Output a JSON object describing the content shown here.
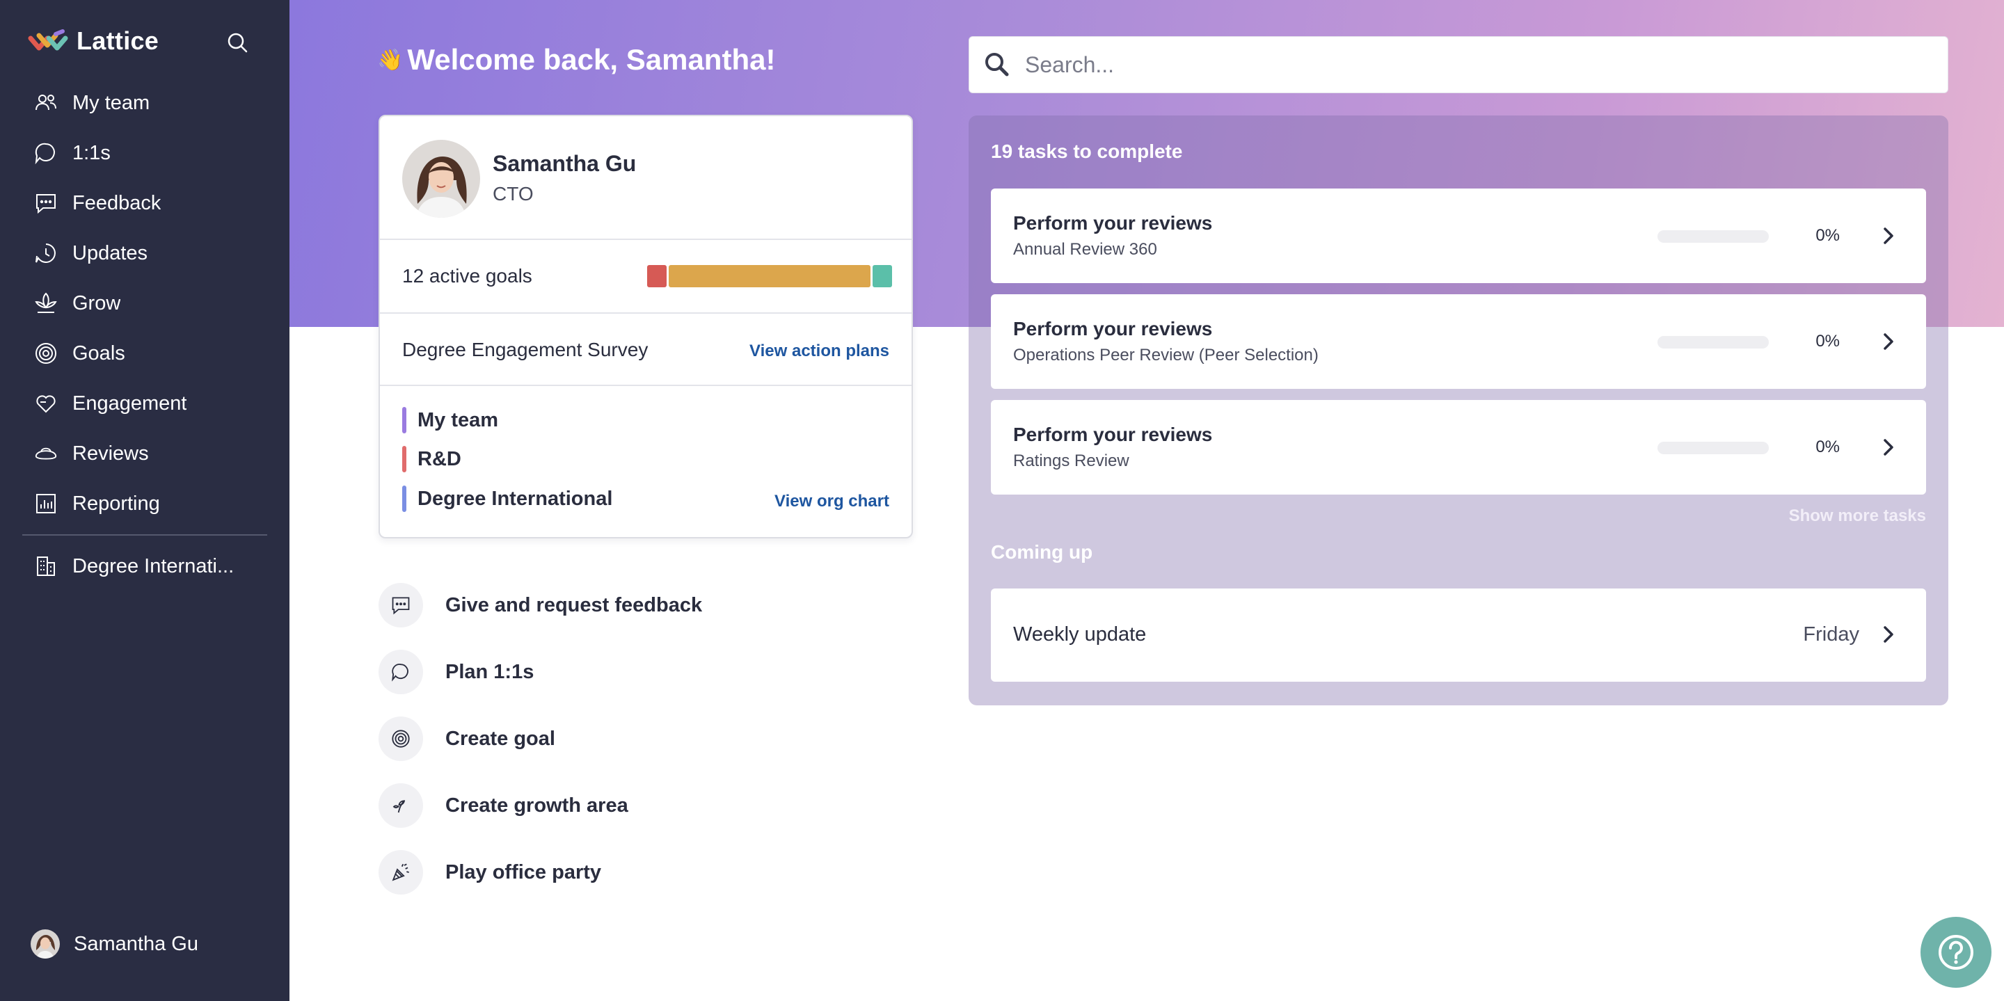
{
  "app": {
    "name": "Lattice",
    "brand_colors": [
      "#e05a4f",
      "#e8a93b",
      "#6cc2b4",
      "#9a7be0"
    ]
  },
  "sidebar": {
    "items": [
      {
        "label": "My team",
        "icon": "people-icon"
      },
      {
        "label": "1:1s",
        "icon": "chat-bubble-icon"
      },
      {
        "label": "Feedback",
        "icon": "feedback-icon"
      },
      {
        "label": "Updates",
        "icon": "updates-icon"
      },
      {
        "label": "Grow",
        "icon": "sprout-icon"
      },
      {
        "label": "Goals",
        "icon": "target-icon"
      },
      {
        "label": "Engagement",
        "icon": "heart-icon"
      },
      {
        "label": "Reviews",
        "icon": "reviews-icon"
      },
      {
        "label": "Reporting",
        "icon": "bar-chart-icon"
      }
    ],
    "org_item": {
      "label": "Degree Internati...",
      "icon": "building-icon"
    },
    "user": {
      "name": "Samantha Gu"
    }
  },
  "welcome": {
    "emoji": "👋",
    "text": "Welcome back, Samantha!"
  },
  "profile": {
    "name": "Samantha Gu",
    "role": "CTO",
    "goals_label": "12 active goals",
    "goal_status": [
      {
        "status": "off-track",
        "fraction": 0.08,
        "color": "#d65a55"
      },
      {
        "status": "progressing",
        "fraction": 0.84,
        "color": "#dca64c"
      },
      {
        "status": "on-track",
        "fraction": 0.08,
        "color": "#5bbfa9"
      }
    ],
    "survey": {
      "label": "Degree Engagement Survey",
      "action": "View action plans"
    },
    "org": {
      "teams": [
        {
          "label": "My team",
          "color": "#9a7be0"
        },
        {
          "label": "R&D",
          "color": "#e06c6c"
        },
        {
          "label": "Degree International",
          "color": "#7a8ee3"
        }
      ],
      "action": "View org chart"
    }
  },
  "quick_actions": [
    {
      "label": "Give and request feedback",
      "icon": "feedback-icon"
    },
    {
      "label": "Plan 1:1s",
      "icon": "chat-bubble-icon"
    },
    {
      "label": "Create goal",
      "icon": "target-icon"
    },
    {
      "label": "Create growth area",
      "icon": "sprout-icon"
    },
    {
      "label": "Play office party",
      "icon": "party-popper-icon"
    }
  ],
  "search": {
    "placeholder": "Search..."
  },
  "tasks": {
    "title": "19 tasks to complete",
    "items": [
      {
        "title": "Perform your reviews",
        "subtitle": "Annual Review 360",
        "progress": 0,
        "progress_label": "0%"
      },
      {
        "title": "Perform your reviews",
        "subtitle": "Operations Peer Review (Peer Selection)",
        "progress": 0,
        "progress_label": "0%"
      },
      {
        "title": "Perform your reviews",
        "subtitle": "Ratings Review",
        "progress": 0,
        "progress_label": "0%"
      }
    ],
    "show_more": "Show more tasks"
  },
  "coming_up": {
    "title": "Coming up",
    "items": [
      {
        "label": "Weekly update",
        "when": "Friday"
      }
    ]
  },
  "help": {
    "icon": "help-question-icon"
  }
}
